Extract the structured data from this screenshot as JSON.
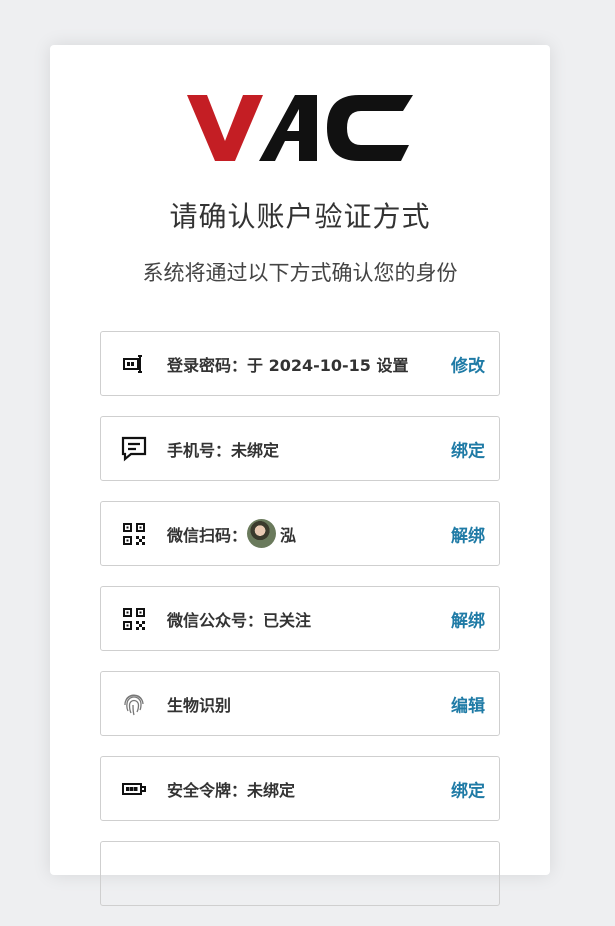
{
  "brand": {
    "name": "VAC"
  },
  "header": {
    "title": "请确认账户验证方式",
    "subtitle": "系统将通过以下方式确认您的身份"
  },
  "methods": [
    {
      "icon": "password-icon",
      "label": "登录密码：",
      "value": "于 2024-10-15 设置",
      "action": "修改"
    },
    {
      "icon": "sms-icon",
      "label": "手机号：",
      "value": "未绑定",
      "action": "绑定"
    },
    {
      "icon": "qrcode-icon",
      "label": "微信扫码：",
      "value": "泓",
      "action": "解绑"
    },
    {
      "icon": "qrcode-icon",
      "label": "微信公众号：",
      "value": "已关注",
      "action": "解绑"
    },
    {
      "icon": "fingerprint-icon",
      "label": "生物识别",
      "value": "",
      "action": "编辑"
    },
    {
      "icon": "token-icon",
      "label": "安全令牌：",
      "value": "未绑定",
      "action": "绑定"
    }
  ],
  "colors": {
    "accent": "#1f7ba6",
    "brand_red": "#c41e24",
    "brand_dark": "#111111"
  }
}
